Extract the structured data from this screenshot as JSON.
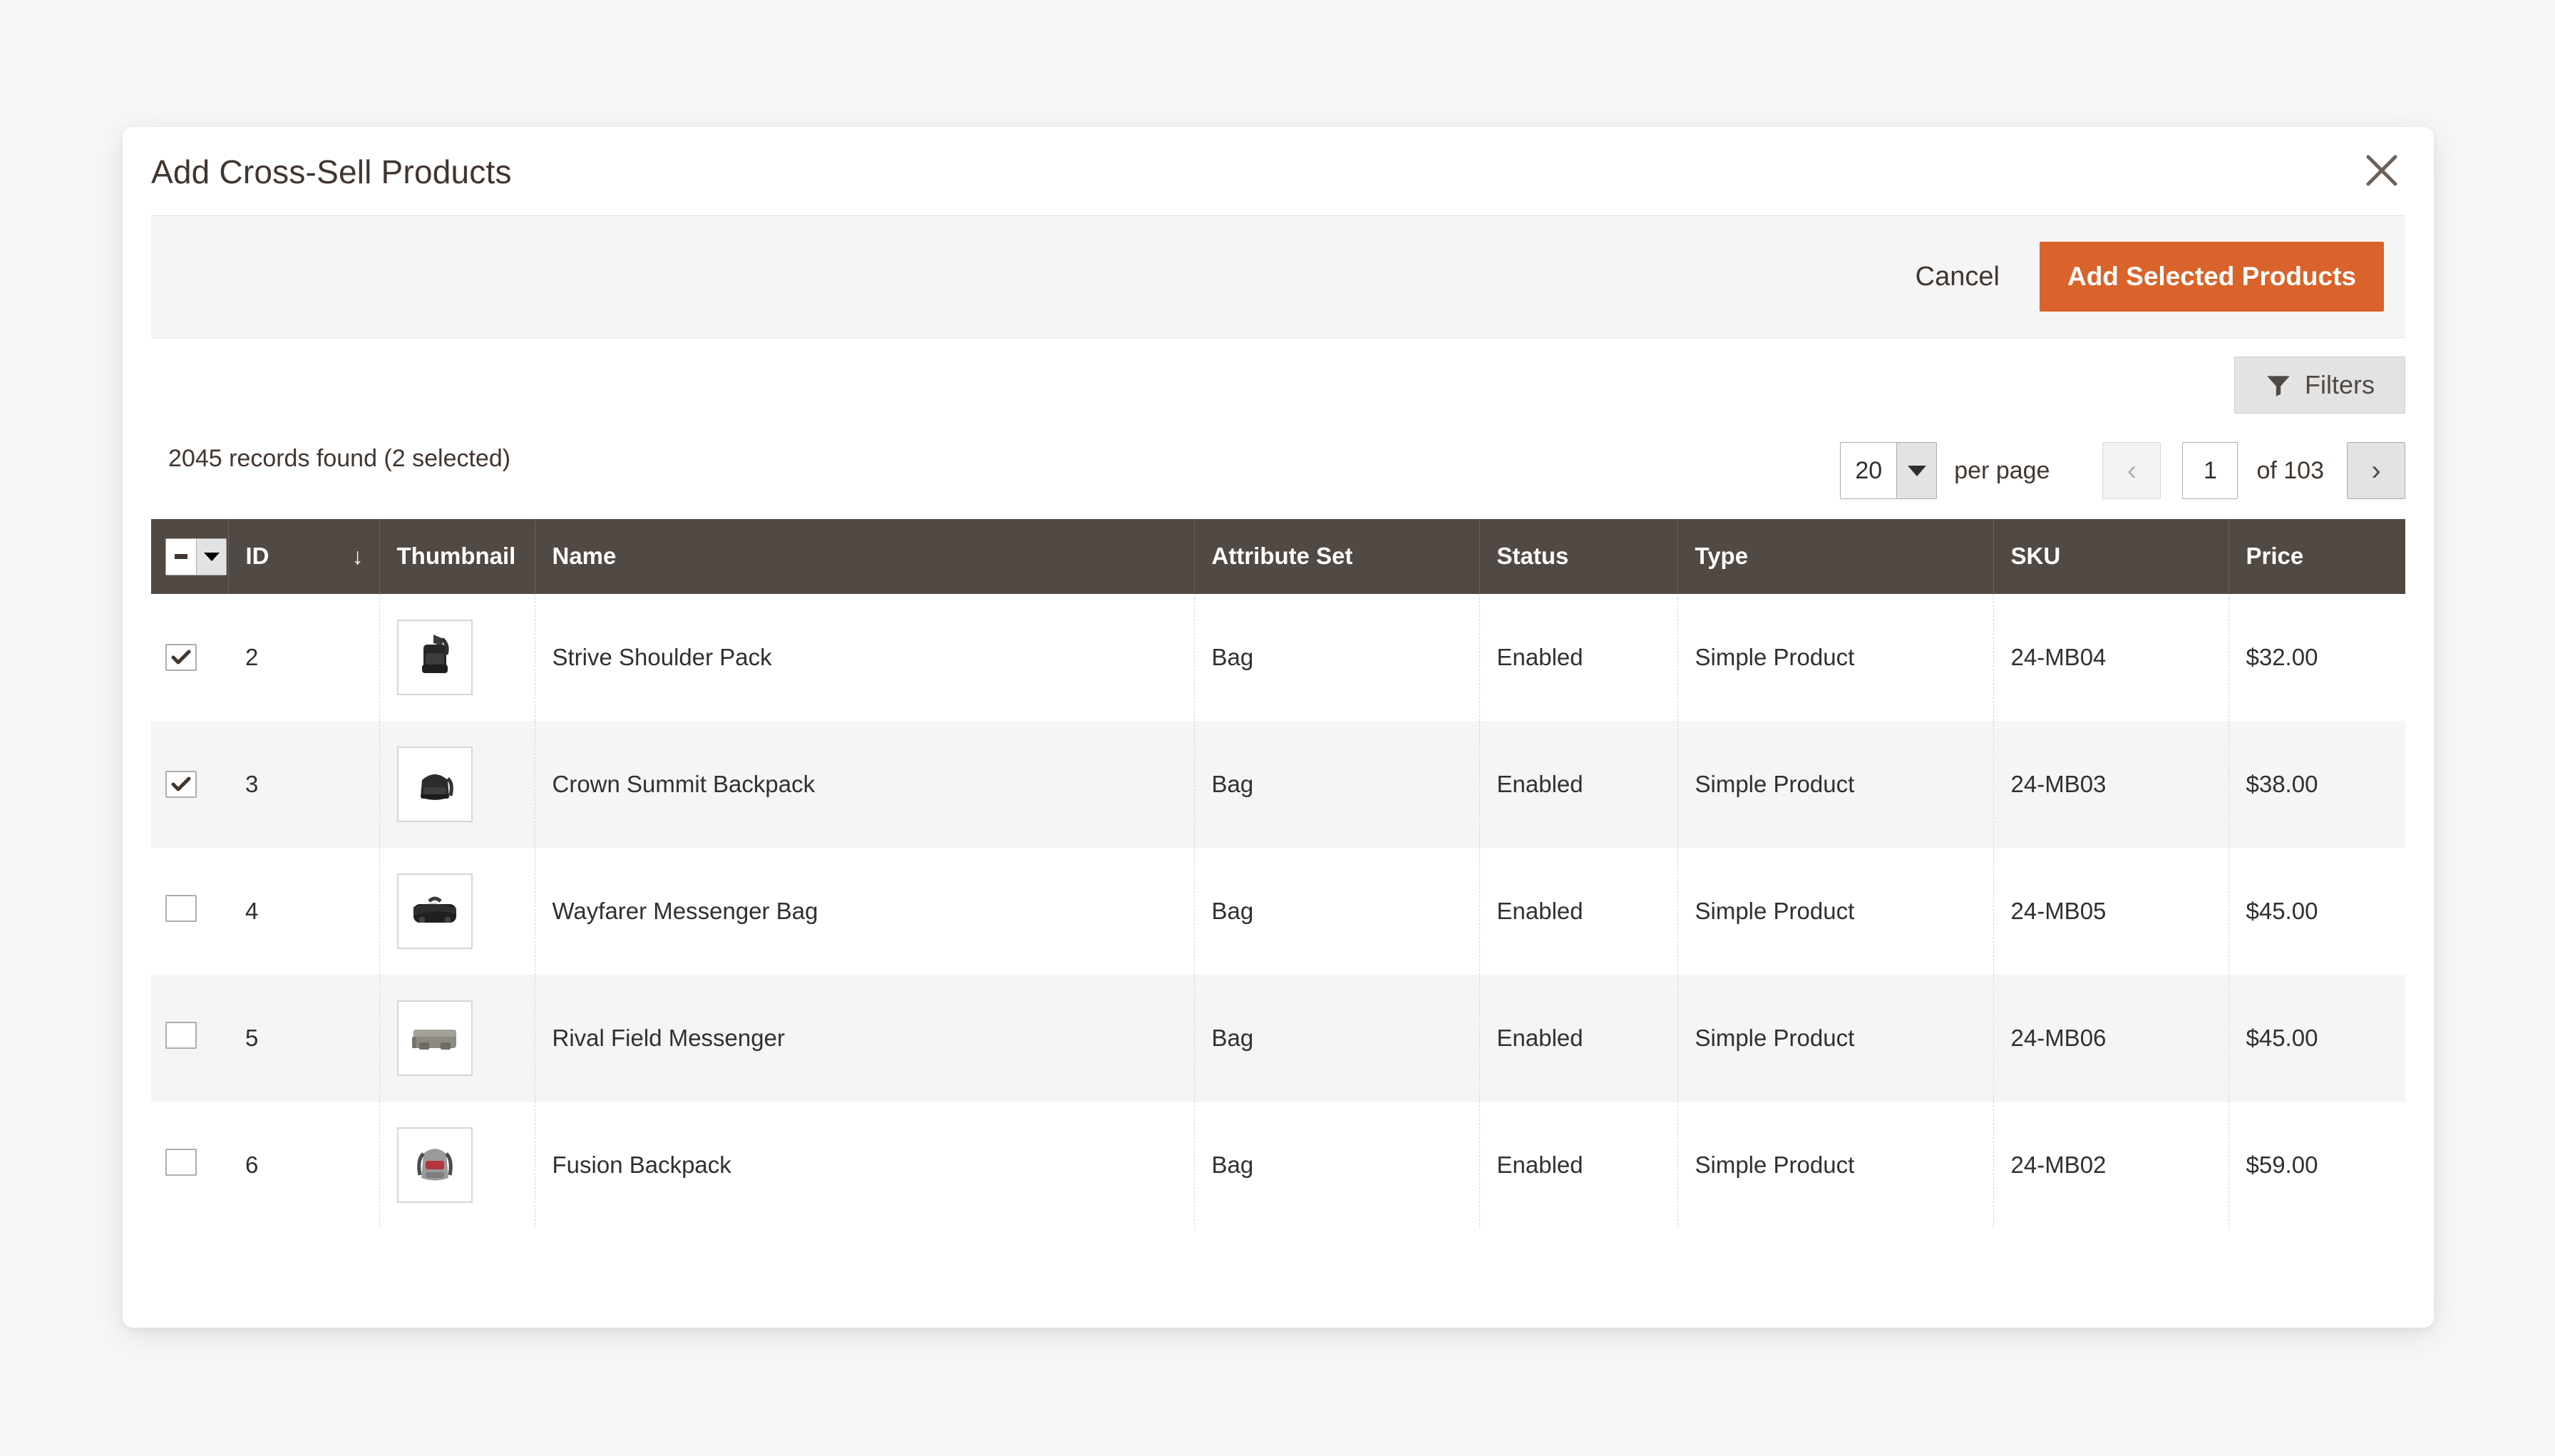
{
  "modal": {
    "title": "Add Cross-Sell Products",
    "close_icon": "close-icon"
  },
  "actions": {
    "cancel_label": "Cancel",
    "add_selected_label": "Add Selected Products",
    "primary_color": "#d9632a"
  },
  "filters": {
    "label": "Filters",
    "icon": "filter-funnel-icon"
  },
  "toolbar": {
    "records_found": "2045 records found (2 selected)",
    "per_page_value": "20",
    "per_page_label": "per page",
    "prev_icon": "chevron-left-icon",
    "next_icon": "chevron-right-icon",
    "current_page": "1",
    "of_total": "of 103"
  },
  "grid": {
    "select_all_state": "indeterminate",
    "sort_column": "ID",
    "sort_direction": "desc",
    "sort_icon": "arrow-down-icon",
    "columns": [
      {
        "key": "check",
        "label": ""
      },
      {
        "key": "id",
        "label": "ID"
      },
      {
        "key": "thumb",
        "label": "Thumbnail"
      },
      {
        "key": "name",
        "label": "Name"
      },
      {
        "key": "attr",
        "label": "Attribute Set"
      },
      {
        "key": "status",
        "label": "Status"
      },
      {
        "key": "type",
        "label": "Type"
      },
      {
        "key": "sku",
        "label": "SKU"
      },
      {
        "key": "price",
        "label": "Price"
      }
    ],
    "rows": [
      {
        "selected": true,
        "id": "2",
        "thumbnail": "shoulder-pack-thumbnail",
        "name": "Strive Shoulder Pack",
        "attribute_set": "Bag",
        "status": "Enabled",
        "type": "Simple Product",
        "sku": "24-MB04",
        "price": "$32.00"
      },
      {
        "selected": true,
        "id": "3",
        "thumbnail": "backpack-thumbnail",
        "name": "Crown Summit Backpack",
        "attribute_set": "Bag",
        "status": "Enabled",
        "type": "Simple Product",
        "sku": "24-MB03",
        "price": "$38.00"
      },
      {
        "selected": false,
        "id": "4",
        "thumbnail": "messenger-bag-thumbnail",
        "name": "Wayfarer Messenger Bag",
        "attribute_set": "Bag",
        "status": "Enabled",
        "type": "Simple Product",
        "sku": "24-MB05",
        "price": "$45.00"
      },
      {
        "selected": false,
        "id": "5",
        "thumbnail": "field-messenger-thumbnail",
        "name": "Rival Field Messenger",
        "attribute_set": "Bag",
        "status": "Enabled",
        "type": "Simple Product",
        "sku": "24-MB06",
        "price": "$45.00"
      },
      {
        "selected": false,
        "id": "6",
        "thumbnail": "fusion-backpack-thumbnail",
        "name": "Fusion Backpack",
        "attribute_set": "Bag",
        "status": "Enabled",
        "type": "Simple Product",
        "sku": "24-MB02",
        "price": "$59.00"
      }
    ]
  }
}
